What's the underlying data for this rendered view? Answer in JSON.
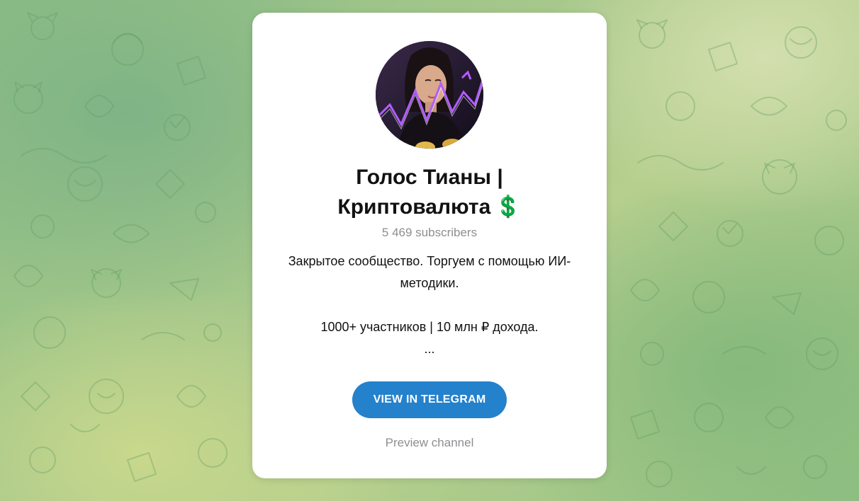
{
  "channel": {
    "title_line1": "Голос Тианы |",
    "title_line2": "Криптовалюта",
    "title_emoji": "💲",
    "subscribers": "5 469 subscribers",
    "description": {
      "line1": "Закрытое сообщество. Торгуем с помощью ИИ-",
      "line2": "методики.",
      "line3": "1000+ участников | 10 млн ₽ дохода.",
      "line4": "..."
    },
    "avatar_icon": "channel-avatar-photo"
  },
  "actions": {
    "view_button_label": "VIEW IN TELEGRAM",
    "preview_link_label": "Preview channel"
  },
  "colors": {
    "accent": "#2481cc",
    "muted_text": "#8e8e93",
    "card": "#ffffff",
    "background_green": "#8bbd84"
  }
}
